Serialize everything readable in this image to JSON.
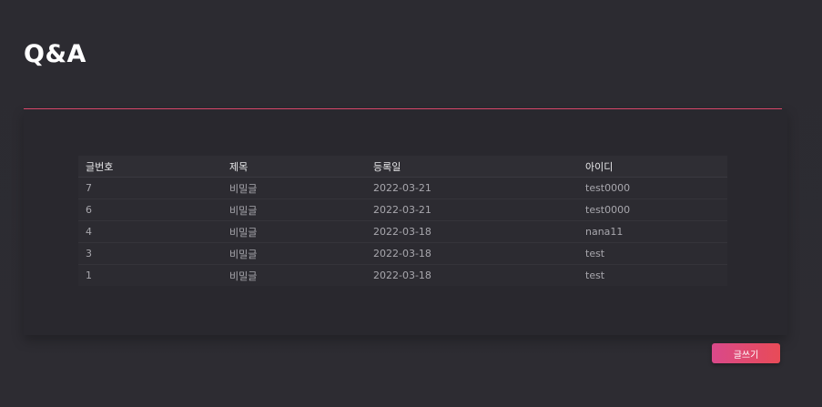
{
  "page": {
    "title": "Q&A"
  },
  "table": {
    "headers": {
      "no": "글번호",
      "title": "제목",
      "date": "등록일",
      "author": "아이디"
    },
    "rows": [
      {
        "no": "7",
        "title": "비밀글",
        "date": "2022-03-21",
        "author": "test0000"
      },
      {
        "no": "6",
        "title": "비밀글",
        "date": "2022-03-21",
        "author": "test0000"
      },
      {
        "no": "4",
        "title": "비밀글",
        "date": "2022-03-18",
        "author": "nana11"
      },
      {
        "no": "3",
        "title": "비밀글",
        "date": "2022-03-18",
        "author": "test"
      },
      {
        "no": "1",
        "title": "비밀글",
        "date": "2022-03-18",
        "author": "test"
      }
    ]
  },
  "actions": {
    "write_label": "글쓰기"
  },
  "colors": {
    "accent": "#e04a6e",
    "button_gradient_start": "#d9498a",
    "button_gradient_end": "#e84b57",
    "background": "#2c2b31"
  }
}
